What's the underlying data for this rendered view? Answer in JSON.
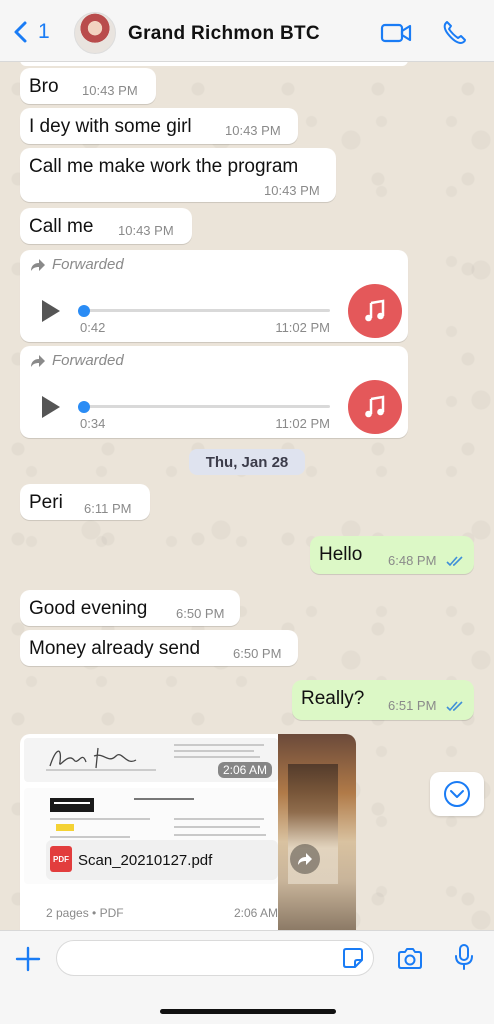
{
  "header": {
    "back_count": "1",
    "contact_name": "Grand  Richmon  BTC",
    "video_icon": "video-camera-icon",
    "call_icon": "phone-icon"
  },
  "messages": [
    {
      "text": "Bro",
      "time": "10:43 PM"
    },
    {
      "text": "I dey with some girl",
      "time": "10:43 PM"
    },
    {
      "text": "Call me make work the program",
      "time": "10:43 PM"
    },
    {
      "text": "Call me",
      "time": "10:43 PM"
    }
  ],
  "audio": [
    {
      "label": "Forwarded",
      "duration": "0:42",
      "time": "11:02 PM",
      "progress": 0
    },
    {
      "label": "Forwarded",
      "duration": "0:34",
      "time": "11:02 PM",
      "progress": 0
    }
  ],
  "date_divider": "Thu, Jan 28",
  "messages2": [
    {
      "text": "Peri",
      "time": "6:11 PM",
      "dir": "in"
    },
    {
      "text": "Hello",
      "time": "6:48 PM",
      "dir": "out"
    },
    {
      "text": "Good evening",
      "time": "6:50 PM",
      "dir": "in"
    },
    {
      "text": "Money already send",
      "time": "6:50 PM",
      "dir": "in"
    },
    {
      "text": "Really?",
      "time": "6:51 PM",
      "dir": "out"
    }
  ],
  "media": {
    "image_time": "2:06 AM",
    "file_name": "Scan_20210127.pdf",
    "file_badge": "PDF",
    "file_meta": "2 pages • PDF",
    "file_time": "2:06 AM"
  },
  "colors": {
    "accent": "#1a7cf5",
    "outgoing_bubble": "#dcf8c6",
    "music_icon_bg": "#e4585a"
  }
}
